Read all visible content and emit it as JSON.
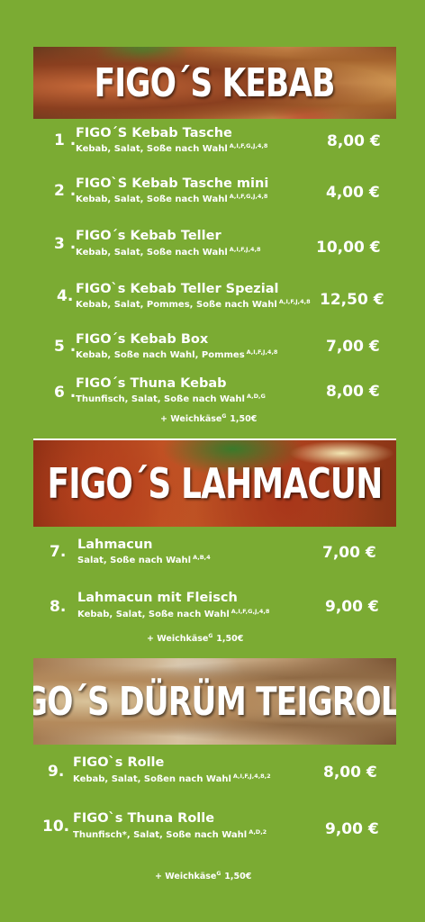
{
  "sections": [
    {
      "title": "FIGO´S KEBAB",
      "items": [
        {
          "num": "1 .",
          "name": "FIGO´S Kebab Tasche",
          "desc": "Kebab, Salat, Soße nach Wahl",
          "allergens": "A,I,F,G,J,4,8",
          "price": "8,00 €"
        },
        {
          "num": "2 .",
          "name": "FIGO`S Kebab Tasche mini",
          "desc": "Kebab, Salat, Soße nach Wahl",
          "allergens": "A,I,F,G,J,4,8",
          "price": "4,00 €"
        },
        {
          "num": "3 .",
          "name": "FIGO´s Kebab Teller",
          "desc": "Kebab, Salat, Soße nach Wahl",
          "allergens": "A,I,F,J,4,8",
          "price": "10,00 €"
        },
        {
          "num": "4.",
          "name": "FIGO`s Kebab Teller Spezial",
          "desc": "Kebab, Salat, Pommes, Soße nach Wahl",
          "allergens": "A,I,F,J,4,8",
          "price": "12,50 €"
        },
        {
          "num": "5 .",
          "name": "FIGO´s Kebab Box",
          "desc": "Kebab, Soße nach Wahl, Pommes",
          "allergens": "A,I,F,J,4,8",
          "price": "7,00 €"
        },
        {
          "num": "6 .",
          "name": "FIGO´s Thuna Kebab",
          "desc": "Thunfisch, Salat, Soße nach Wahl",
          "allergens": "A,D,G",
          "price": "8,00 €"
        }
      ],
      "extra": {
        "label": "+ Weichkäse",
        "sup": "G",
        "price": "1,50€"
      }
    },
    {
      "title": "FIGO´S LAHMACUN",
      "items": [
        {
          "num": "7.",
          "name": "Lahmacun",
          "desc": "Salat, Soße nach Wahl",
          "allergens": "A,B,4",
          "price": "7,00 €"
        },
        {
          "num": "8.",
          "name": "Lahmacun mit Fleisch",
          "desc": "Kebab, Salat, Soße nach Wahl",
          "allergens": "A,I,F,G,J,4,8",
          "price": "9,00 €"
        }
      ],
      "extra": {
        "label": "+ Weichkäse",
        "sup": "G",
        "price": "1,50€"
      }
    },
    {
      "title": "FIGO´S DÜRÜM TEIGROLLE",
      "items": [
        {
          "num": "9.",
          "name": "FIGO`s Rolle",
          "desc": "Kebab, Salat, Soßen nach Wahl",
          "allergens": "A,I,F,J,4,8,2",
          "price": "8,00 €"
        },
        {
          "num": "10.",
          "name": "FIGO`s Thuna Rolle",
          "desc": "Thunfisch*, Salat, Soße nach Wahl",
          "allergens": "A,D,2",
          "price": "9,00 €"
        }
      ],
      "extra": {
        "label": "+ Weichkäse",
        "sup": "G",
        "price": "1,50€"
      }
    }
  ],
  "colors": {
    "background": "#7bab33",
    "text": "#ffffff"
  }
}
